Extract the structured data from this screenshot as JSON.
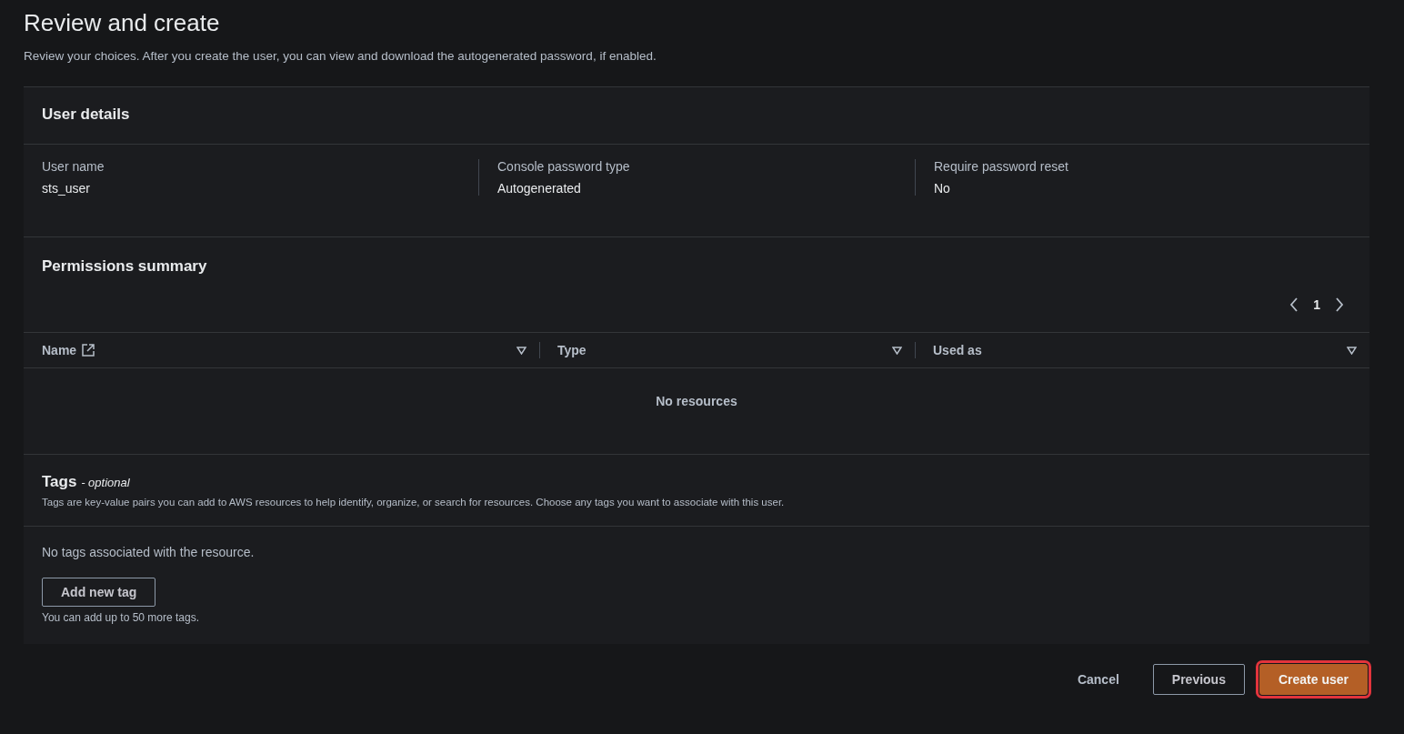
{
  "page": {
    "title": "Review and create",
    "description": "Review your choices. After you create the user, you can view and download the autogenerated password, if enabled."
  },
  "user_details": {
    "title": "User details",
    "fields": [
      {
        "label": "User name",
        "value": "sts_user"
      },
      {
        "label": "Console password type",
        "value": "Autogenerated"
      },
      {
        "label": "Require password reset",
        "value": "No"
      }
    ]
  },
  "permissions_summary": {
    "title": "Permissions summary",
    "pagination": {
      "page": "1"
    },
    "columns": [
      {
        "label": "Name",
        "external_link": true
      },
      {
        "label": "Type",
        "external_link": false
      },
      {
        "label": "Used as",
        "external_link": false
      }
    ],
    "empty_text": "No resources"
  },
  "tags": {
    "title": "Tags",
    "title_suffix": "- optional",
    "description": "Tags are key-value pairs you can add to AWS resources to help identify, organize, or search for resources. Choose any tags you want to associate with this user.",
    "empty_text": "No tags associated with the resource.",
    "add_button": "Add new tag",
    "limit_text": "You can add up to 50 more tags."
  },
  "actions": [
    {
      "label": "Cancel",
      "kind": "link",
      "highlighted": false
    },
    {
      "label": "Previous",
      "kind": "secondary",
      "highlighted": false
    },
    {
      "label": "Create user",
      "kind": "primary",
      "highlighted": true
    }
  ]
}
